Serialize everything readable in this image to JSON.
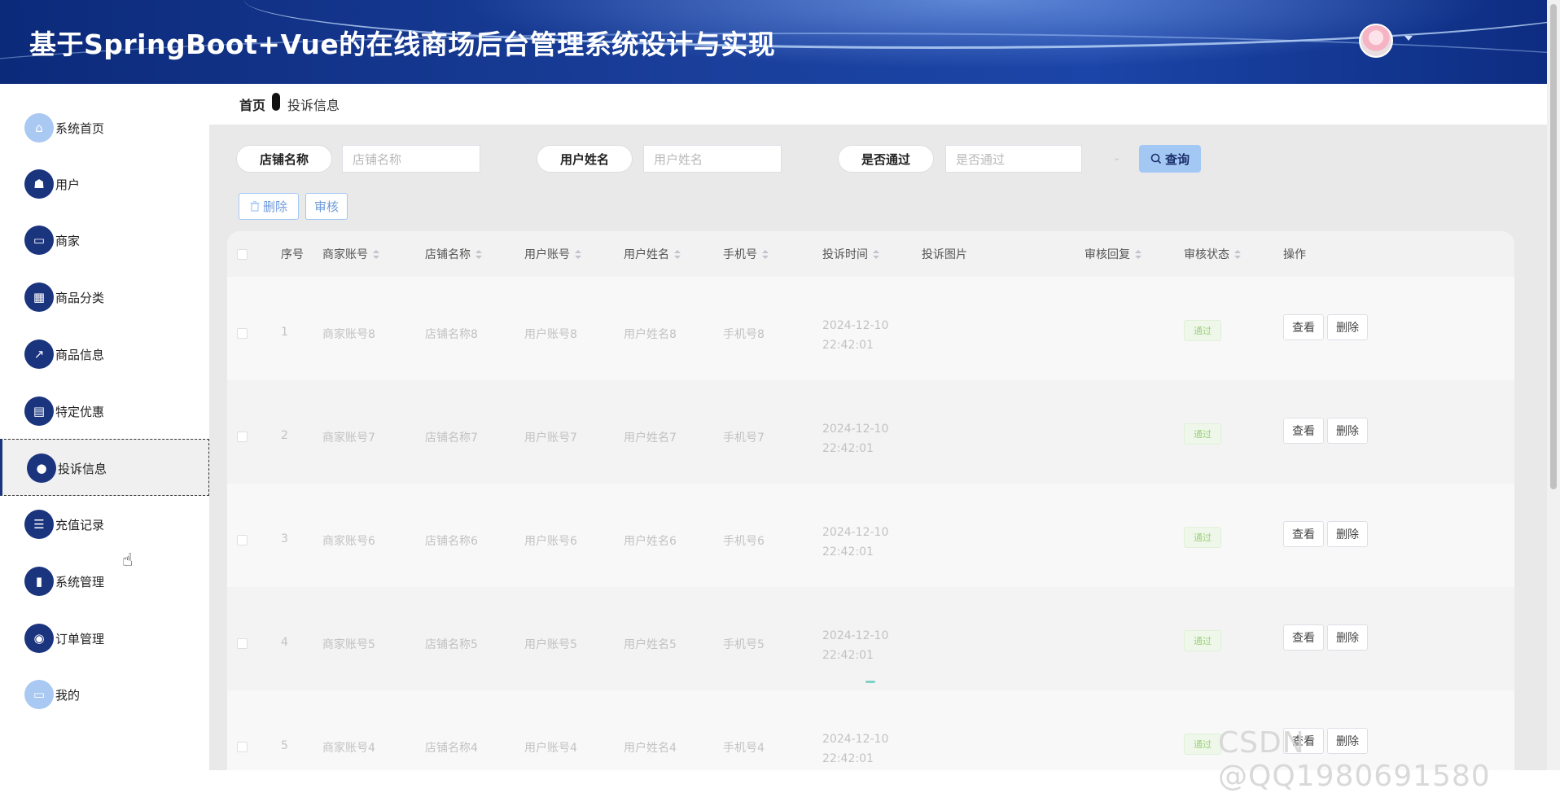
{
  "header": {
    "title": "基于SpringBoot+Vue的在线商场后台管理系统设计与实现"
  },
  "breadcrumb": {
    "home": "首页",
    "current": "投诉信息"
  },
  "sidebar": {
    "items": [
      {
        "label": "系统首页",
        "icon": "home-icon"
      },
      {
        "label": "用户",
        "icon": "user-icon"
      },
      {
        "label": "商家",
        "icon": "monitor-icon"
      },
      {
        "label": "商品分类",
        "icon": "grid-icon"
      },
      {
        "label": "商品信息",
        "icon": "chart-icon"
      },
      {
        "label": "特定优惠",
        "icon": "clipboard-icon"
      },
      {
        "label": "投诉信息",
        "icon": "person-icon"
      },
      {
        "label": "充值记录",
        "icon": "list-icon"
      },
      {
        "label": "系统管理",
        "icon": "bar-chart-icon"
      },
      {
        "label": "订单管理",
        "icon": "bulb-icon"
      },
      {
        "label": "我的",
        "icon": "card-icon"
      }
    ],
    "active_index": 6
  },
  "search": {
    "shop_label": "店铺名称",
    "shop_placeholder": "店铺名称",
    "user_label": "用户姓名",
    "user_placeholder": "用户姓名",
    "pass_label": "是否通过",
    "pass_placeholder": "是否通过",
    "query_label": "查询"
  },
  "actions": {
    "delete_label": "删除",
    "review_label": "审核"
  },
  "table": {
    "columns": [
      "序号",
      "商家账号",
      "店铺名称",
      "用户账号",
      "用户姓名",
      "手机号",
      "投诉时间",
      "投诉图片",
      "审核回复",
      "审核状态",
      "操作"
    ],
    "rows": [
      {
        "index": "1",
        "merchant": "商家账号8",
        "shop": "店铺名称8",
        "account": "用户账号8",
        "name": "用户姓名8",
        "phone": "手机号8",
        "time": "2024-12-10 22:42:01",
        "status": "通过"
      },
      {
        "index": "2",
        "merchant": "商家账号7",
        "shop": "店铺名称7",
        "account": "用户账号7",
        "name": "用户姓名7",
        "phone": "手机号7",
        "time": "2024-12-10 22:42:01",
        "status": "通过"
      },
      {
        "index": "3",
        "merchant": "商家账号6",
        "shop": "店铺名称6",
        "account": "用户账号6",
        "name": "用户姓名6",
        "phone": "手机号6",
        "time": "2024-12-10 22:42:01",
        "status": "通过"
      },
      {
        "index": "4",
        "merchant": "商家账号5",
        "shop": "店铺名称5",
        "account": "用户账号5",
        "name": "用户姓名5",
        "phone": "手机号5",
        "time": "2024-12-10 22:42:01",
        "status": "通过"
      },
      {
        "index": "5",
        "merchant": "商家账号4",
        "shop": "店铺名称4",
        "account": "用户账号4",
        "name": "用户姓名4",
        "phone": "手机号4",
        "time": "2024-12-10 22:42:01",
        "status": "通过"
      }
    ],
    "view_label": "查看",
    "delete_label": "删除"
  },
  "watermark": "CSDN @QQ1980691580",
  "colors": {
    "header_blue": "#1a3f9b",
    "nav_icon": "#1a347e",
    "query_button": "#a4c8f4",
    "badge_green": "#9ed17c"
  }
}
